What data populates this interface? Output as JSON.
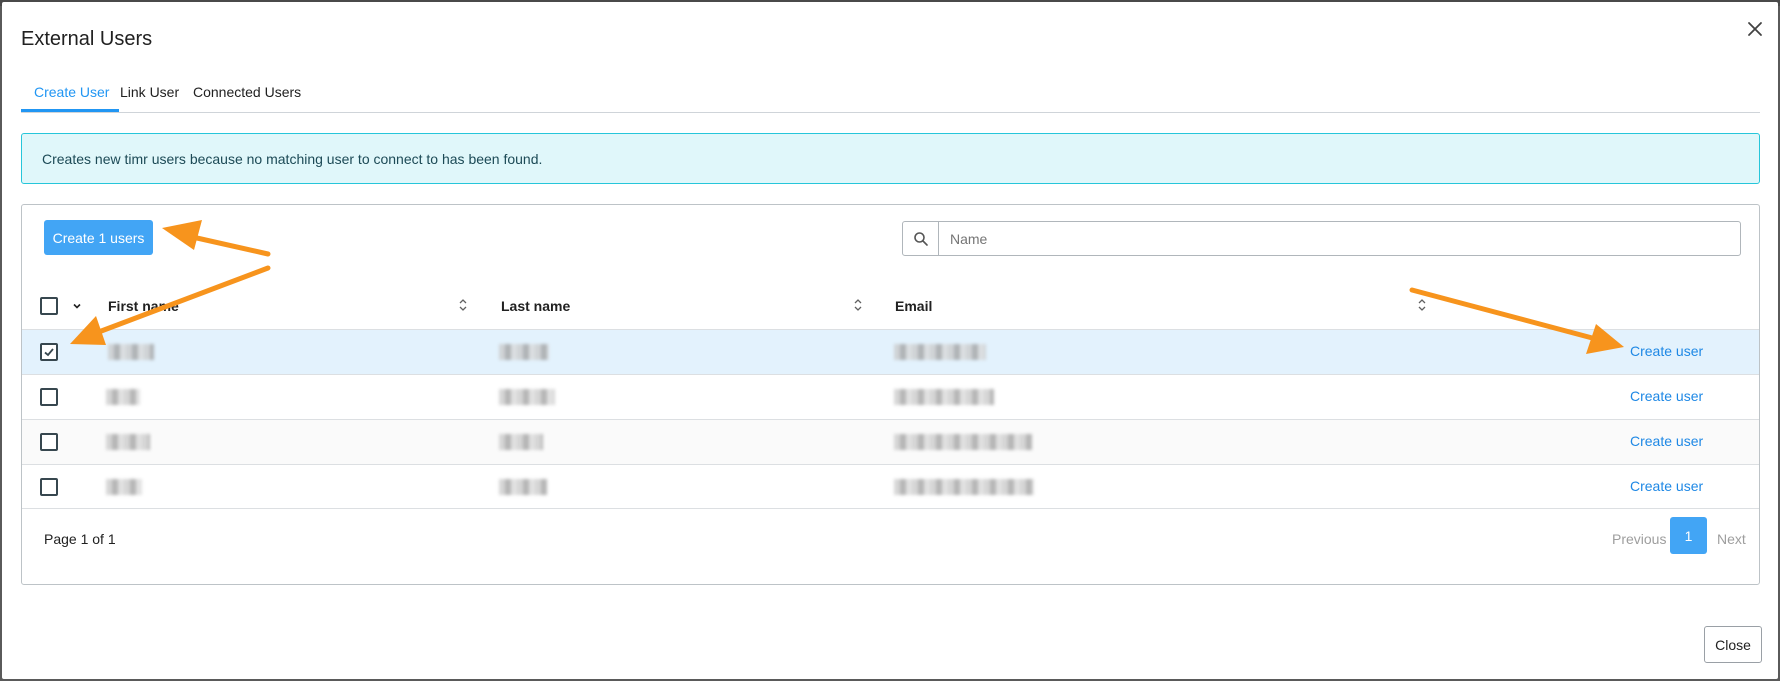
{
  "dialog": {
    "title": "External Users",
    "close_icon": "close-icon"
  },
  "tabs": [
    {
      "label": "Create User",
      "active": true
    },
    {
      "label": "Link User",
      "active": false
    },
    {
      "label": "Connected Users",
      "active": false
    }
  ],
  "info": {
    "text": "Creates new timr users because no matching user to connect to has been found."
  },
  "toolbar": {
    "create_batch_label": "Create 1 users",
    "search_placeholder": "Name",
    "search_value": "",
    "search_icon": "search-icon"
  },
  "table": {
    "columns": [
      {
        "label": "First name"
      },
      {
        "label": "Last name"
      },
      {
        "label": "Email"
      }
    ],
    "rows": [
      {
        "checked": true,
        "action_label": "Create user"
      },
      {
        "checked": false,
        "action_label": "Create user"
      },
      {
        "checked": false,
        "action_label": "Create user"
      },
      {
        "checked": false,
        "action_label": "Create user"
      }
    ]
  },
  "pagination": {
    "info": "Page 1 of 1",
    "previous_label": "Previous",
    "current_page": "1",
    "next_label": "Next"
  },
  "footer": {
    "close_label": "Close"
  },
  "colors": {
    "accent": "#2196f3",
    "button_primary": "#42a5f5",
    "info_bg": "#e0f7fa",
    "info_border": "#26c6da",
    "selected_row": "#e3f2fd",
    "annotation_arrow": "#f7941d"
  }
}
